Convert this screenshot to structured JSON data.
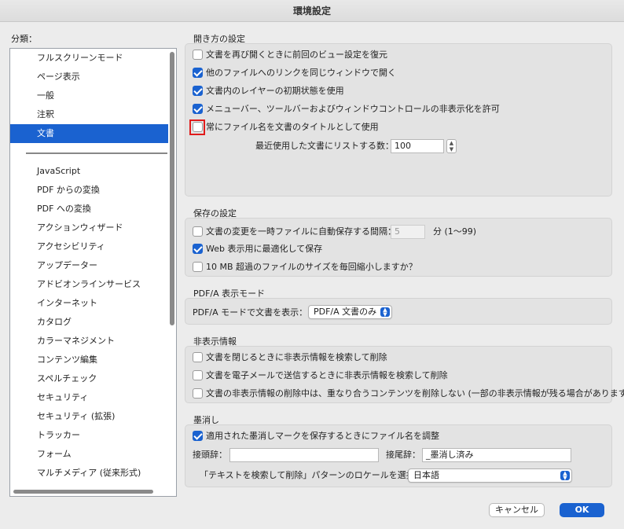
{
  "window": {
    "title": "環境設定"
  },
  "sidebar": {
    "label": "分類：",
    "items": [
      {
        "label": "フルスクリーンモード",
        "selected": false
      },
      {
        "label": "ページ表示",
        "selected": false
      },
      {
        "label": "一般",
        "selected": false
      },
      {
        "label": "注釈",
        "selected": false
      },
      {
        "label": "文書",
        "selected": true
      }
    ],
    "items2": [
      {
        "label": "JavaScript"
      },
      {
        "label": "PDF からの変換"
      },
      {
        "label": "PDF への変換"
      },
      {
        "label": "アクションウィザード"
      },
      {
        "label": "アクセシビリティ"
      },
      {
        "label": "アップデーター"
      },
      {
        "label": "アドビオンラインサービス"
      },
      {
        "label": "インターネット"
      },
      {
        "label": "カタログ"
      },
      {
        "label": "カラーマネジメント"
      },
      {
        "label": "コンテンツ編集"
      },
      {
        "label": "スペルチェック"
      },
      {
        "label": "セキュリティ"
      },
      {
        "label": "セキュリティ (拡張)"
      },
      {
        "label": "トラッカー"
      },
      {
        "label": "フォーム"
      },
      {
        "label": "マルチメディア (従来形式)"
      }
    ]
  },
  "open": {
    "title": "開き方の設定",
    "opt1": {
      "label": "文書を再び開くときに前回のビュー設定を復元",
      "checked": false
    },
    "opt2": {
      "label": "他のファイルへのリンクを同じウィンドウで開く",
      "checked": true
    },
    "opt3": {
      "label": "文書内のレイヤーの初期状態を使用",
      "checked": true
    },
    "opt4": {
      "label": "メニューバー、ツールバーおよびウィンドウコントロールの非表示化を許可",
      "checked": true
    },
    "opt5": {
      "label": "常にファイル名を文書のタイトルとして使用",
      "checked": false
    },
    "recent_label": "最近使用した文書にリストする数：",
    "recent_value": "100"
  },
  "save": {
    "title": "保存の設定",
    "opt1": {
      "label": "文書の変更を一時ファイルに自動保存する間隔：",
      "checked": false
    },
    "interval_value": "5",
    "interval_unit": "分 (1〜99)",
    "opt2": {
      "label": "Web 表示用に最適化して保存",
      "checked": true
    },
    "opt3": {
      "label": "10 MB 超過のファイルのサイズを毎回縮小しますか？",
      "checked": false
    }
  },
  "pdfa": {
    "title": "PDF/A 表示モード",
    "label": "PDF/A モードで文書を表示：",
    "selected": "PDF/A 文書のみ"
  },
  "hidden": {
    "title": "非表示情報",
    "opt1": {
      "label": "文書を閉じるときに非表示情報を検索して削除",
      "checked": false
    },
    "opt2": {
      "label": "文書を電子メールで送信するときに非表示情報を検索して削除",
      "checked": false
    },
    "opt3": {
      "label": "文書の非表示情報の削除中は、重なり合うコンテンツを削除しない (一部の非表示情報が残る場合があります)",
      "checked": false
    }
  },
  "redact": {
    "title": "墨消し",
    "opt1": {
      "label": "適用された墨消しマークを保存するときにファイル名を調整",
      "checked": true
    },
    "prefix_label": "接頭辞：",
    "prefix_value": "",
    "suffix_label": "接尾辞：",
    "suffix_value": "_墨消し済み",
    "locale_label": "「テキストを検索して削除」パターンのロケールを選択：",
    "locale_value": "日本語"
  },
  "buttons": {
    "cancel": "キャンセル",
    "ok": "OK"
  },
  "colors": {
    "accent": "#1a62d0",
    "highlight": "#e01b1b"
  }
}
